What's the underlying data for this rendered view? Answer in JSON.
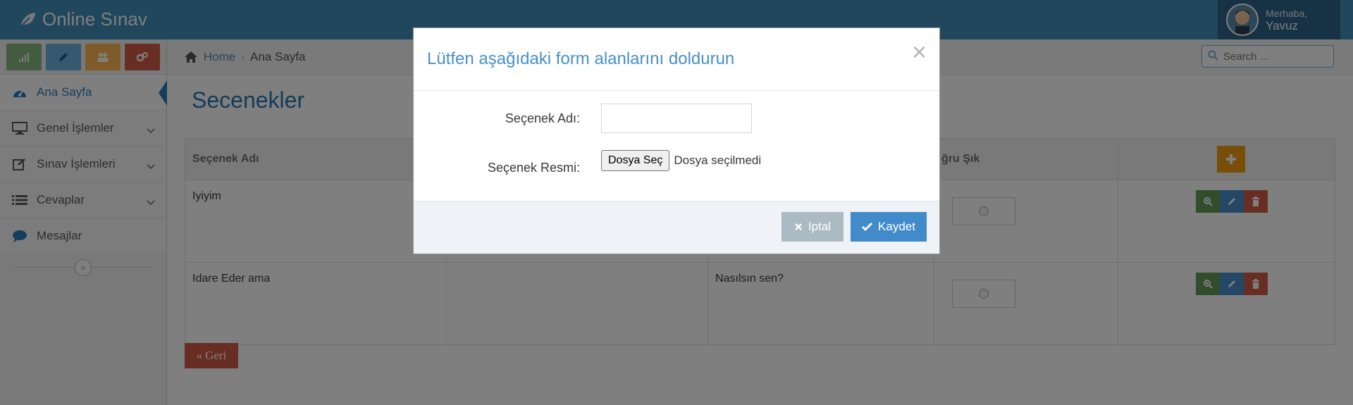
{
  "navbar": {
    "brand": "Online Sınav",
    "greeting": "Merhaba,",
    "username": "Yavuz"
  },
  "shortcuts": [
    {
      "icon": "signal-icon",
      "color": "#87b87f"
    },
    {
      "icon": "pencil-icon",
      "color": "#6fb3e0"
    },
    {
      "icon": "users-icon",
      "color": "#ffb752"
    },
    {
      "icon": "cogs-icon",
      "color": "#d15b47"
    }
  ],
  "sidebar": {
    "items": [
      {
        "label": "Ana Sayfa",
        "icon": "dashboard-icon",
        "active": true
      },
      {
        "label": "Genel İşlemler",
        "icon": "desktop-icon",
        "has_submenu": true
      },
      {
        "label": "Sınav İşlemleri",
        "icon": "edit-icon",
        "has_submenu": true
      },
      {
        "label": "Cevaplar",
        "icon": "list-icon",
        "has_submenu": true
      },
      {
        "label": "Mesajlar",
        "icon": "comment-icon"
      }
    ]
  },
  "breadcrumb": {
    "home": "Home",
    "current": "Ana Sayfa"
  },
  "search": {
    "placeholder": "Search ..."
  },
  "page": {
    "title": "Secenekler"
  },
  "table": {
    "headers": [
      "Seçenek Adı",
      "",
      "",
      "ğru Şık",
      ""
    ],
    "rows": [
      {
        "name": "Iyiyim",
        "col2": "",
        "question": ""
      },
      {
        "name": "Idare Eder ama",
        "col2": "",
        "question": "Nasılsın sen?"
      }
    ]
  },
  "back_button": "Geri",
  "modal": {
    "title": "Lütfen aşağıdaki form alanlarını doldurun",
    "close": "×",
    "option_name_label": "Seçenek Adı:",
    "option_name_value": "",
    "option_image_label": "Seçenek Resmi:",
    "file_button": "Dosya Seç",
    "file_status": "Dosya seçilmedi",
    "cancel": "Iptal",
    "save": "Kaydet"
  },
  "colors": {
    "navbar": "#438eb9",
    "accent": "#2679b5",
    "save": "#428bca",
    "cancel": "#abbac3"
  }
}
